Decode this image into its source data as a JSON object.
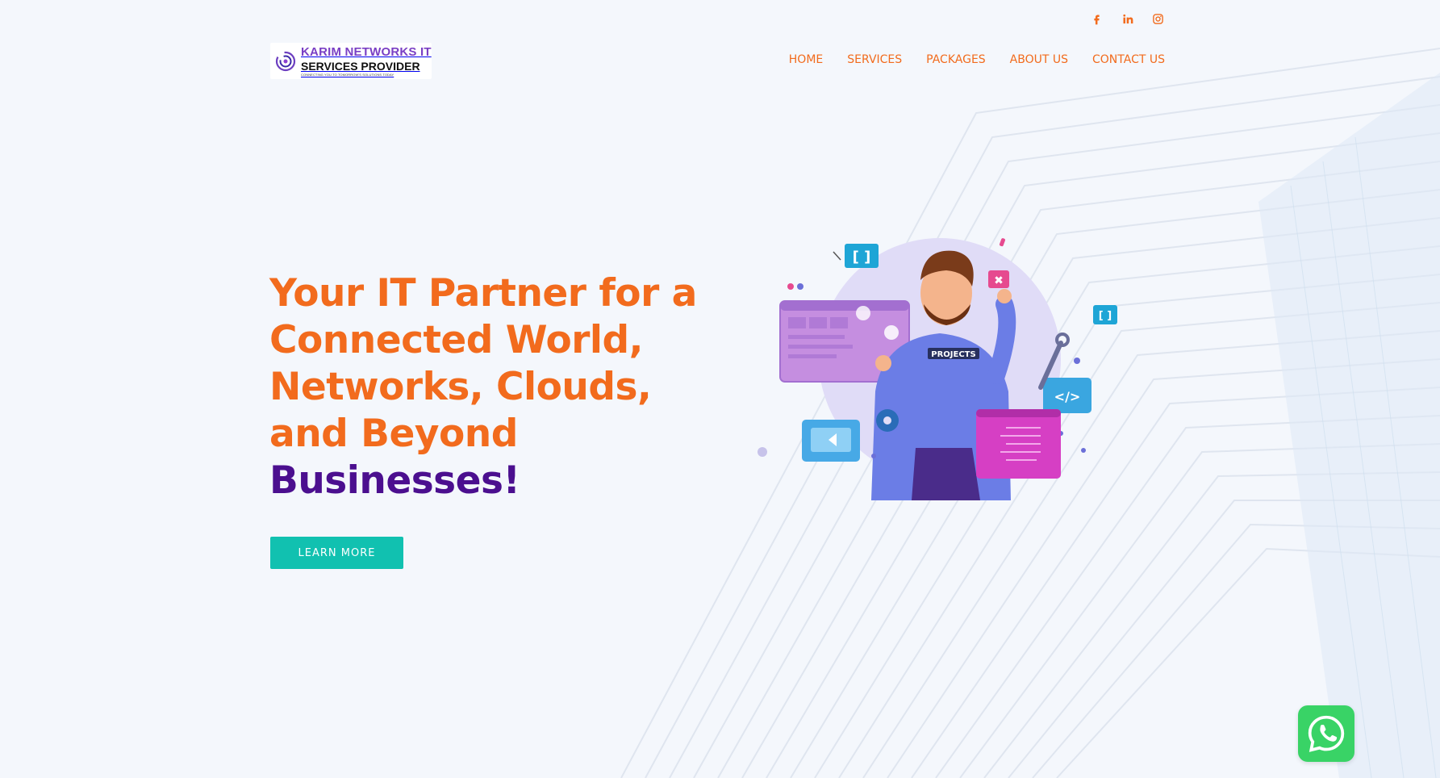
{
  "social": {
    "icons": [
      "facebook-icon",
      "linkedin-icon",
      "instagram-icon"
    ]
  },
  "logo": {
    "line1": "KARIM NETWORKS IT",
    "line2": "SERVICES PROVIDER",
    "tagline": "CONNECTING YOU TO TOMORROW'S SOLUTIONS TODAY"
  },
  "nav": {
    "items": [
      {
        "label": "HOME"
      },
      {
        "label": "SERVICES"
      },
      {
        "label": "PACKAGES"
      },
      {
        "label": "ABOUT US"
      },
      {
        "label": "CONTACT US"
      }
    ]
  },
  "hero": {
    "title_lines": [
      "Your IT Partner for a",
      "Connected World,",
      "Networks, Clouds,",
      "and Beyond"
    ],
    "title_accent": "Businesses!",
    "cta_label": "LEARN MORE",
    "illustration_badge": "PROJECTS"
  },
  "colors": {
    "accent_orange": "#f26b1d",
    "accent_purple": "#4b0f8f",
    "cta_teal": "#11c1b0",
    "whatsapp_green": "#39d366",
    "background": "#f4f7fc"
  },
  "floating": {
    "icon": "whatsapp-icon"
  }
}
